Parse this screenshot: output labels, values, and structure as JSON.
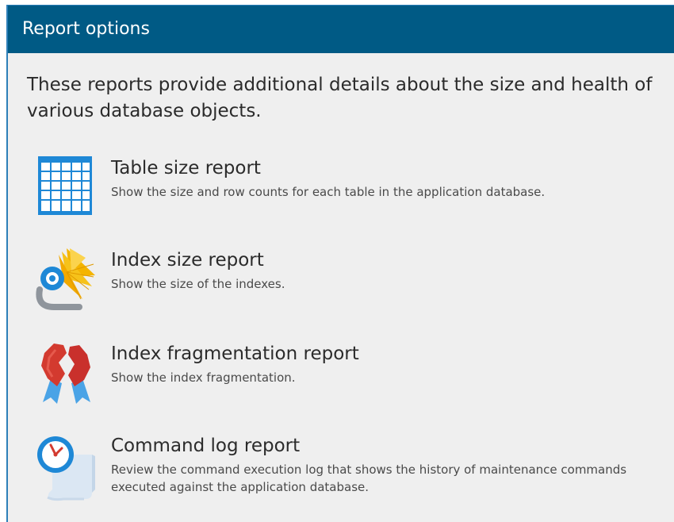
{
  "header": {
    "title": "Report options"
  },
  "intro": "These reports provide additional details about the size and health of various database objects.",
  "reports": [
    {
      "icon": "table-grid-icon",
      "title": "Table size report",
      "description": "Show the size and row counts for each table in the application database."
    },
    {
      "icon": "index-lens-icon",
      "title": "Index size report",
      "description": "Show the size of the indexes."
    },
    {
      "icon": "broken-ribbon-icon",
      "title": "Index fragmentation report",
      "description": "Show the index fragmentation."
    },
    {
      "icon": "clock-log-icon",
      "title": "Command log report",
      "description": "Review the command execution log that shows the history of maintenance commands executed against the application database."
    }
  ],
  "colors": {
    "header_bg": "#005a85",
    "panel_bg": "#efefef",
    "border": "#2d7fb8",
    "icon_blue": "#1e88d6",
    "ribbon_red": "#c9302c"
  }
}
